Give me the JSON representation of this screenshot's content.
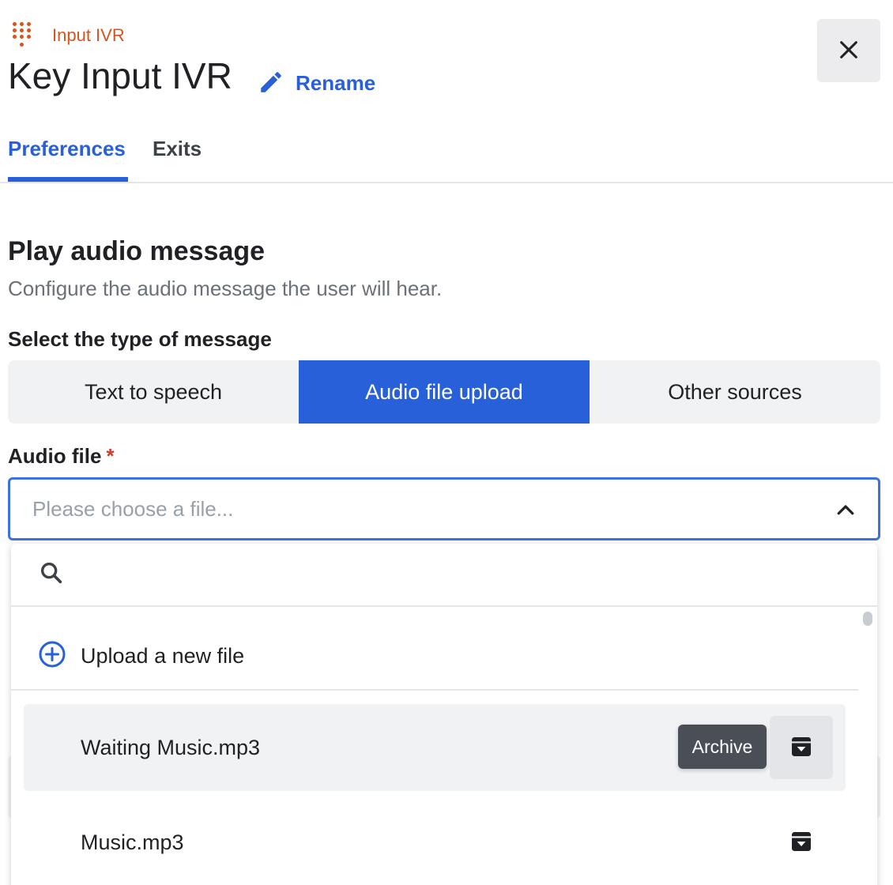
{
  "header": {
    "kind_label": "Input IVR",
    "title": "Key Input IVR",
    "rename_label": "Rename",
    "kind_icon": "dialpad-icon",
    "close_icon": "close-icon"
  },
  "tabs": [
    {
      "label": "Preferences",
      "active": true
    },
    {
      "label": "Exits",
      "active": false
    }
  ],
  "section": {
    "title": "Play audio message",
    "description": "Configure the audio message the user will hear."
  },
  "message_type": {
    "label": "Select the type of message",
    "options": [
      "Text to speech",
      "Audio file upload",
      "Other sources"
    ],
    "selected": "Audio file upload"
  },
  "audio_file": {
    "label": "Audio file",
    "required_mark": "*",
    "placeholder": "Please choose a file...",
    "open": true
  },
  "dropdown": {
    "search_value": "",
    "upload_label": "Upload a new file",
    "files": [
      {
        "name": "Waiting Music.mp3",
        "hovered": true,
        "tooltip": "Archive"
      },
      {
        "name": "Music.mp3",
        "hovered": false
      }
    ]
  },
  "colors": {
    "accent": "#2760d8",
    "kind": "#d9531e",
    "required": "#d13b2b",
    "tooltip_bg": "#4a4f57"
  }
}
